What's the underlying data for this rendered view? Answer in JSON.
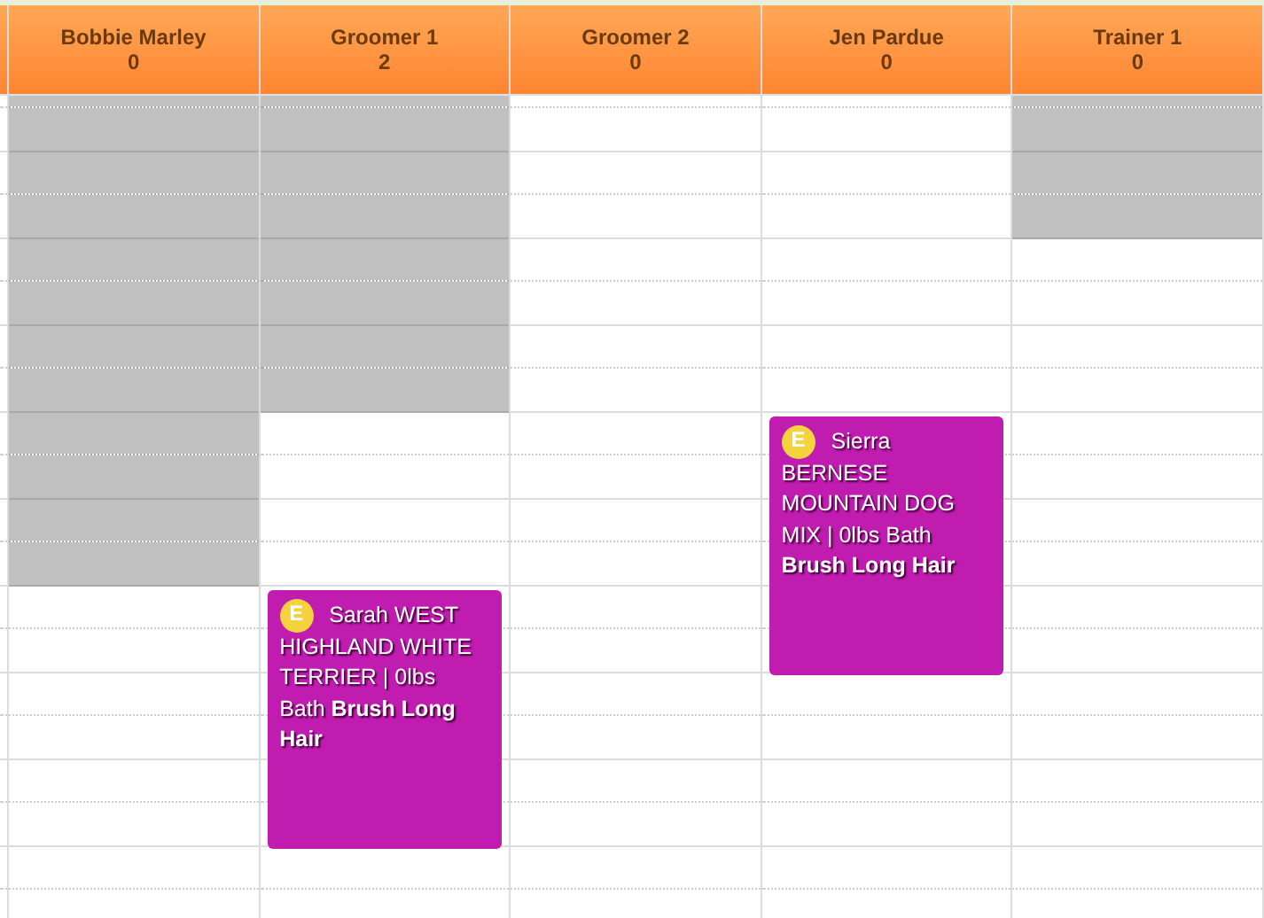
{
  "columns": [
    {
      "name": "Bobbie Marley",
      "count": "0",
      "slots": [
        {
          "blocked": true
        },
        {
          "blocked": true
        },
        {
          "blocked": true
        },
        {
          "blocked": true
        },
        {
          "blocked": true
        },
        {
          "blocked": true
        },
        {
          "blocked": true
        },
        {
          "blocked": true
        },
        {
          "blocked": true
        },
        {
          "blocked": true
        },
        {
          "blocked": true
        },
        {
          "blocked": true
        },
        {
          "blocked": false
        },
        {
          "blocked": false
        },
        {
          "blocked": false
        },
        {
          "blocked": false
        },
        {
          "blocked": false
        },
        {
          "blocked": false
        },
        {
          "blocked": false
        },
        {
          "blocked": false
        }
      ]
    },
    {
      "name": "Groomer 1",
      "count": "2",
      "slots": [
        {
          "blocked": true
        },
        {
          "blocked": true
        },
        {
          "blocked": true
        },
        {
          "blocked": true
        },
        {
          "blocked": true
        },
        {
          "blocked": true
        },
        {
          "blocked": true
        },
        {
          "blocked": true
        },
        {
          "blocked": false
        },
        {
          "blocked": false
        },
        {
          "blocked": false
        },
        {
          "blocked": false
        },
        {
          "blocked": false,
          "appointment": {
            "badge": "E",
            "text": "Sarah WEST HIGHLAND WHITE TERRIER | 0lbs Bath **Brush Long Hair**"
          }
        },
        {
          "blocked": false
        },
        {
          "blocked": false
        },
        {
          "blocked": false
        },
        {
          "blocked": false
        },
        {
          "blocked": false
        },
        {
          "blocked": false
        },
        {
          "blocked": false
        }
      ]
    },
    {
      "name": "Groomer 2",
      "count": "0",
      "slots": [
        {
          "blocked": false
        },
        {
          "blocked": false
        },
        {
          "blocked": false
        },
        {
          "blocked": false
        },
        {
          "blocked": false
        },
        {
          "blocked": false
        },
        {
          "blocked": false
        },
        {
          "blocked": false
        },
        {
          "blocked": false
        },
        {
          "blocked": false
        },
        {
          "blocked": false
        },
        {
          "blocked": false
        },
        {
          "blocked": false
        },
        {
          "blocked": false
        },
        {
          "blocked": false
        },
        {
          "blocked": false
        },
        {
          "blocked": false
        },
        {
          "blocked": false
        },
        {
          "blocked": false
        },
        {
          "blocked": false
        }
      ]
    },
    {
      "name": "Jen Pardue",
      "count": "0",
      "slots": [
        {
          "blocked": false
        },
        {
          "blocked": false
        },
        {
          "blocked": false
        },
        {
          "blocked": false
        },
        {
          "blocked": false
        },
        {
          "blocked": false
        },
        {
          "blocked": false
        },
        {
          "blocked": false
        },
        {
          "blocked": false,
          "appointment": {
            "badge": "E",
            "text": "Sierra BERNESE MOUNTAIN DOG MIX | 0lbs Bath **Brush Long Hair**"
          }
        },
        {
          "blocked": false
        },
        {
          "blocked": false
        },
        {
          "blocked": false
        },
        {
          "blocked": false
        },
        {
          "blocked": false
        },
        {
          "blocked": false
        },
        {
          "blocked": false
        },
        {
          "blocked": false
        },
        {
          "blocked": false
        },
        {
          "blocked": false
        },
        {
          "blocked": false
        }
      ]
    },
    {
      "name": "Trainer 1",
      "count": "0",
      "slots": [
        {
          "blocked": true
        },
        {
          "blocked": true
        },
        {
          "blocked": true
        },
        {
          "blocked": true
        },
        {
          "blocked": false
        },
        {
          "blocked": false
        },
        {
          "blocked": false
        },
        {
          "blocked": false
        },
        {
          "blocked": false
        },
        {
          "blocked": false
        },
        {
          "blocked": false
        },
        {
          "blocked": false
        },
        {
          "blocked": false
        },
        {
          "blocked": false
        },
        {
          "blocked": false
        },
        {
          "blocked": false
        },
        {
          "blocked": false
        },
        {
          "blocked": false
        },
        {
          "blocked": false
        },
        {
          "blocked": false
        }
      ]
    }
  ]
}
